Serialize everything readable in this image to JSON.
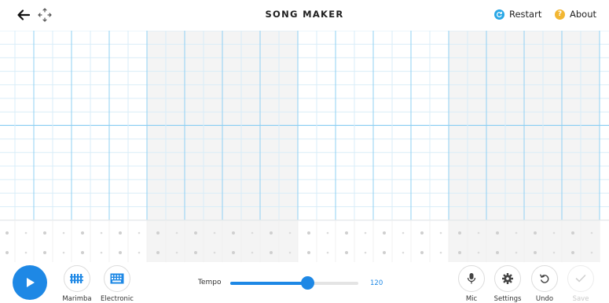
{
  "header": {
    "title": "SONG MAKER",
    "restart_label": "Restart",
    "about_label": "About"
  },
  "colors": {
    "accent": "#1e88e5",
    "restart_icon": "#29a7e6",
    "about_icon": "#f2b632",
    "grid_line": "#d9edf8",
    "grid_strong_line": "#8fd0f3",
    "shaded_column": "#f4f4f4"
  },
  "icons": {
    "back": "arrow-left-icon",
    "move": "move-arrows-icon",
    "restart": "refresh-icon",
    "about": "question-icon",
    "play": "play-icon",
    "marimba": "marimba-icon",
    "electronic": "keyboard-icon",
    "mic": "microphone-icon",
    "settings": "gear-icon",
    "undo": "undo-icon",
    "save": "check-icon"
  },
  "toolbar": {
    "marimba_label": "Marimba",
    "electronic_label": "Electronic",
    "tempo_label": "Tempo",
    "tempo_value": "120",
    "tempo_fraction": 0.6,
    "mic_label": "Mic",
    "settings_label": "Settings",
    "undo_label": "Undo",
    "save_label": "Save"
  }
}
